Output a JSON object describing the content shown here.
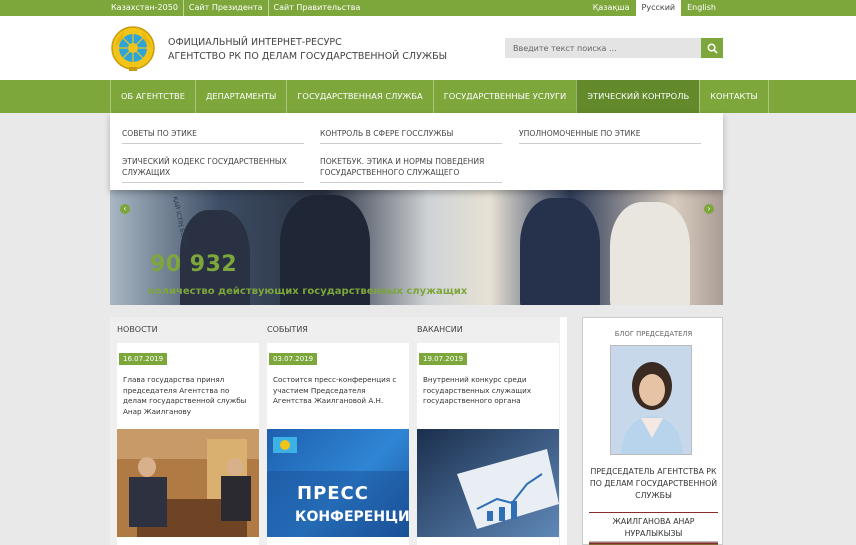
{
  "topbar": {
    "links": [
      "Казахстан-2050",
      "Сайт Президента",
      "Сайт Правительства"
    ],
    "languages": [
      "Қазақша",
      "Русский",
      "English"
    ],
    "active_language": "Русский"
  },
  "header": {
    "title_line1": "ОФИЦИАЛЬНЫЙ ИНТЕРНЕТ-РЕСУРС",
    "title_line2": "АГЕНТСТВО РК ПО ДЕЛАМ ГОСУДАРСТВЕННОЙ СЛУЖБЫ",
    "search_placeholder": "Введите текст поиска ..."
  },
  "nav": {
    "items": [
      "ОБ АГЕНТСТВЕ",
      "ДЕПАРТАМЕНТЫ",
      "ГОСУДАРСТВЕННАЯ СЛУЖБА",
      "ГОСУДАРСТВЕННЫЕ УСЛУГИ",
      "ЭТИЧЕСКИЙ КОНТРОЛЬ",
      "КОНТАКТЫ"
    ],
    "active": "ЭТИЧЕСКИЙ КОНТРОЛЬ"
  },
  "dropdown": {
    "items": [
      "СОВЕТЫ ПО ЭТИКЕ",
      "КОНТРОЛЬ В СФЕРЕ ГОССЛУЖБЫ",
      "УПОЛНОМОЧЕННЫЕ ПО ЭТИКЕ",
      "ЭТИЧЕСКИЙ КОДЕКС ГОСУДАРСТВЕННЫХ СЛУЖАЩИХ",
      "ПОКЕТБУК. ЭТИКА И НОРМЫ ПОВЕДЕНИЯ ГОСУДАРСТВЕННОГО СЛУЖАЩЕГО"
    ]
  },
  "banner": {
    "number": "90 932",
    "caption": "количество действующих государственных служащих",
    "poster_text": "ҚАЙ ІСТІҢ БОЛМ",
    "prev_glyph": "‹",
    "next_glyph": "›"
  },
  "columns": [
    {
      "header": "НОВОСТИ",
      "date": "16.07.2019",
      "text": "Глава государства принял председателя Агентства по делам государственной службы Анар Жаилганову"
    },
    {
      "header": "СОБЫТИЯ",
      "date": "03.07.2019",
      "text": "Состоится пресс-конференция с участием Председателя Агентства Жаилгановой А.Н.",
      "image_text_1": "ПРЕСС",
      "image_text_2": "КОНФЕРЕНЦИЯ"
    },
    {
      "header": "ВАКАНСИИ",
      "date": "19.07.2019",
      "text": "Внутренний конкурс среди государственных служащих государственного органа"
    }
  ],
  "sidebar": {
    "title": "БЛОГ ПРЕДСЕДАТЕЛЯ",
    "position": "ПРЕДСЕДАТЕЛЬ АГЕНТСТВА РК ПО ДЕЛАМ ГОСУДАРСТВЕННОЙ СЛУЖБЫ",
    "name": "ЖАИЛГАНОВА АНАР НУРАЛЫКЫЗЫ"
  },
  "colors": {
    "accent": "#7da63b",
    "accent_dark": "#628a2a",
    "page_bg": "#e9e9e9"
  },
  "icons": {
    "emblem": "state-emblem-icon",
    "search": "search-icon",
    "prev": "arrow-left-icon",
    "next": "arrow-right-icon"
  }
}
